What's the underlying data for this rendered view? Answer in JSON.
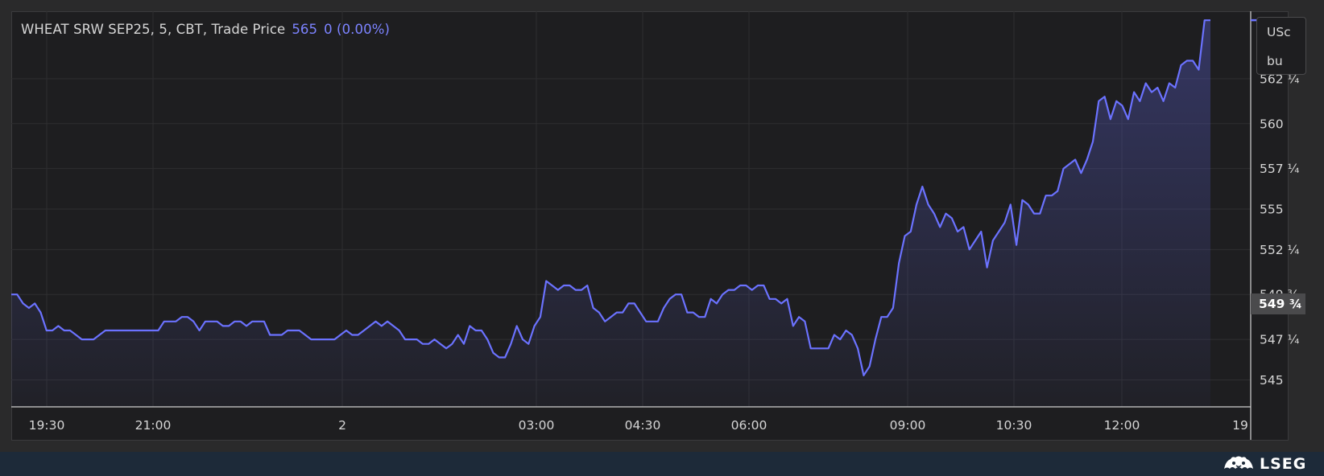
{
  "legend": {
    "instrument": "WHEAT SRW SEP25, 5, CBT, Trade Price",
    "last_value": "565",
    "change": "0 (0.00%)"
  },
  "unit": {
    "line1": "USc",
    "line2": "bu"
  },
  "last_price_badge": "549 ¾",
  "brand": "LSEG",
  "colors": {
    "series": "#6b72ff",
    "background": "#1e1e20",
    "grid": "#2e2e30",
    "text": "#d6d6d6"
  },
  "chart_data": {
    "type": "area",
    "title": "WHEAT SRW SEP25, 5, CBT, Trade Price",
    "y_axis_side": "right",
    "ylim": [
      543.5,
      565.5
    ],
    "x_ticks": [
      "19:30",
      "21:00",
      "2",
      "03:00",
      "04:30",
      "06:00",
      "09:00",
      "10:30",
      "12:00",
      "19"
    ],
    "y_ticks": [
      {
        "value": 545,
        "label": "545"
      },
      {
        "value": 547.25,
        "label": "547 ¼"
      },
      {
        "value": 549.75,
        "label": "549 ¾"
      },
      {
        "value": 552.25,
        "label": "552 ¼"
      },
      {
        "value": 554.5,
        "label": "555"
      },
      {
        "value": 556.75,
        "label": "557 ¼"
      },
      {
        "value": 559.25,
        "label": "560"
      },
      {
        "value": 561.75,
        "label": "562 ¼"
      }
    ],
    "grid": true,
    "series": [
      {
        "values": [
          549.75,
          549.75,
          549.25,
          549,
          549.25,
          548.75,
          547.75,
          547.75,
          548,
          547.75,
          547.75,
          547.5,
          547.25,
          547.25,
          547.25,
          547.5,
          547.75,
          547.75,
          547.75,
          547.75,
          547.75,
          547.75,
          547.75,
          547.75,
          547.75,
          547.75,
          548.25,
          548.25,
          548.25,
          548.5,
          548.5,
          548.25,
          547.75,
          548.25,
          548.25,
          548.25,
          548,
          548,
          548.25,
          548.25,
          548,
          548.25,
          548.25,
          548.25,
          547.5,
          547.5,
          547.5,
          547.75,
          547.75,
          547.75,
          547.5,
          547.25,
          547.25,
          547.25,
          547.25,
          547.25,
          547.5,
          547.75,
          547.5,
          547.5,
          547.75,
          548,
          548.25,
          548,
          548.25,
          548,
          547.75,
          547.25,
          547.25,
          547.25,
          547,
          547,
          547.25,
          547,
          546.75,
          547,
          547.5,
          547,
          548,
          547.75,
          547.75,
          547.25,
          546.5,
          546.25,
          546.25,
          547,
          548,
          547.25,
          547,
          548,
          548.5,
          550.5,
          550.25,
          550,
          550.25,
          550.25,
          550,
          550,
          550.25,
          549,
          548.75,
          548.25,
          548.5,
          548.75,
          548.75,
          549.25,
          549.25,
          548.75,
          548.25,
          548.25,
          548.25,
          549,
          549.5,
          549.75,
          549.75,
          548.75,
          548.75,
          548.5,
          548.5,
          549.5,
          549.25,
          549.75,
          550,
          550,
          550.25,
          550.25,
          550,
          550.25,
          550.25,
          549.5,
          549.5,
          549.25,
          549.5,
          548,
          548.5,
          548.25,
          546.75,
          546.75,
          546.75,
          546.75,
          547.5,
          547.25,
          547.75,
          547.5,
          546.75,
          545.25,
          545.75,
          547.25,
          548.5,
          548.5,
          549,
          551.5,
          553,
          553.25,
          554.75,
          555.75,
          554.75,
          554.25,
          553.5,
          554.25,
          554,
          553.25,
          553.5,
          552.25,
          552.75,
          553.25,
          551.25,
          552.75,
          553.25,
          553.75,
          554.75,
          552.5,
          555,
          554.75,
          554.25,
          554.25,
          555.25,
          555.25,
          555.5,
          556.75,
          557,
          557.25,
          556.5,
          557.25,
          558.25,
          560.5,
          560.75,
          559.5,
          560.5,
          560.25,
          559.5,
          561,
          560.5,
          561.5,
          561,
          561.25,
          560.5,
          561.5,
          561.25,
          562.5,
          562.75,
          562.75,
          562.25,
          565,
          565
        ]
      }
    ]
  }
}
